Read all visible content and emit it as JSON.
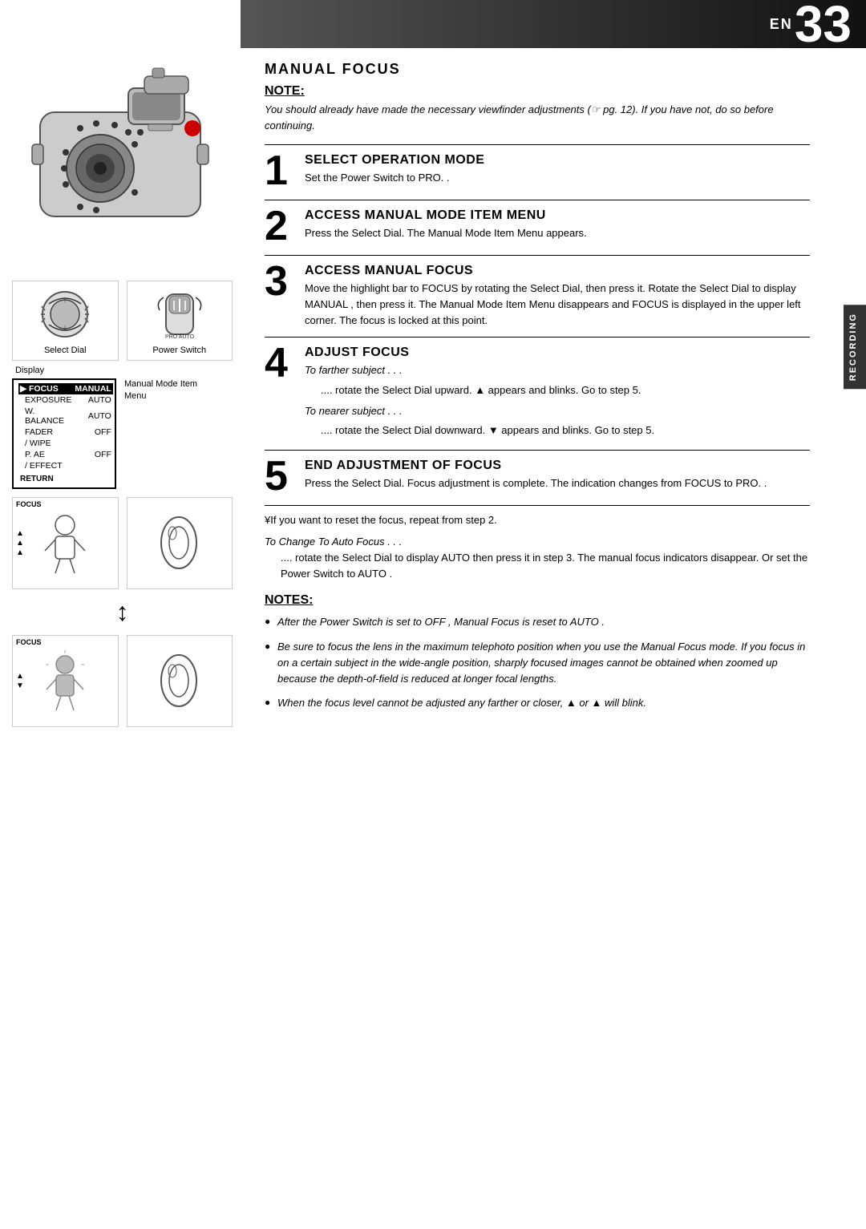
{
  "header": {
    "en_label": "EN",
    "page_number": "33",
    "gradient_start": "#555",
    "gradient_end": "#111"
  },
  "page_title": "MANUAL FOCUS",
  "note": {
    "heading": "NOTE:",
    "text": "You should already have made the necessary viewfinder adjustments (☞ pg. 12). If you have not, do so before continuing."
  },
  "steps": [
    {
      "number": "1",
      "heading": "SELECT OPERATION MODE",
      "body": "Set the Power Switch to  PRO. ."
    },
    {
      "number": "2",
      "heading": "ACCESS MANUAL MODE ITEM MENU",
      "body": "Press the Select Dial. The Manual Mode Item Menu appears."
    },
    {
      "number": "3",
      "heading": "ACCESS MANUAL FOCUS",
      "body": "Move the highlight bar to  FOCUS  by rotating the Select Dial, then press it. Rotate the Select Dial to display  MANUAL , then press it. The Manual Mode Item Menu disappears and  FOCUS  is displayed in the upper left corner. The focus is locked at this point."
    },
    {
      "number": "4",
      "heading": "ADJUST FOCUS",
      "farther_label": "To farther subject . . .",
      "farther_body": ".... rotate the Select Dial upward. ▲  appears and blinks. Go to step 5.",
      "nearer_label": "To nearer subject . . .",
      "nearer_body": ".... rotate the Select Dial downward. ▼  appears and blinks. Go to step 5."
    },
    {
      "number": "5",
      "heading": "END ADJUSTMENT OF FOCUS",
      "body": "Press the Select Dial. Focus adjustment is complete. The indication changes from  FOCUS  to  PRO. ."
    }
  ],
  "yen_note": "¥If you want to reset the focus, repeat from step 2.",
  "change_focus_title": "To Change To Auto Focus . . .",
  "change_focus_body": ".... rotate the Select Dial to display  AUTO  then press it in step 3. The manual focus indicators disappear. Or set the Power Switch to  AUTO .",
  "notes": {
    "heading": "NOTES:",
    "items": [
      "After the Power Switch is set to  OFF , Manual Focus is reset to  AUTO .",
      "Be sure to focus the lens in the maximum telephoto position when you use the Manual Focus mode. If you focus in on a certain subject in the wide-angle position, sharply focused images cannot be obtained when zoomed up because the depth-of-field is reduced at longer focal lengths.",
      "When the focus level cannot be adjusted any farther or closer, ▲  or  ▲  will blink."
    ]
  },
  "diagrams": {
    "select_dial_label": "Select Dial",
    "power_switch_label": "Power Switch",
    "display_label": "Display",
    "menu_label": "Manual Mode Item\nMenu",
    "menu_items": [
      {
        "name": "FOCUS",
        "value": "MANUAL",
        "highlight": true
      },
      {
        "name": "EXPOSURE",
        "value": "AUTO",
        "highlight": false
      },
      {
        "name": "W. BALANCE",
        "value": "AUTO",
        "highlight": false
      },
      {
        "name": "FADER",
        "value": "OFF",
        "highlight": false
      },
      {
        "name": "/ WIPE",
        "value": "",
        "highlight": false
      },
      {
        "name": "P. AE",
        "value": "OFF",
        "highlight": false
      },
      {
        "name": "/ EFFECT",
        "value": "",
        "highlight": false
      },
      {
        "name": "RETURN",
        "value": "",
        "highlight": false
      }
    ],
    "focus_top_label": "FOCUS",
    "recording_label": "RECORDING"
  },
  "or_text": "or"
}
